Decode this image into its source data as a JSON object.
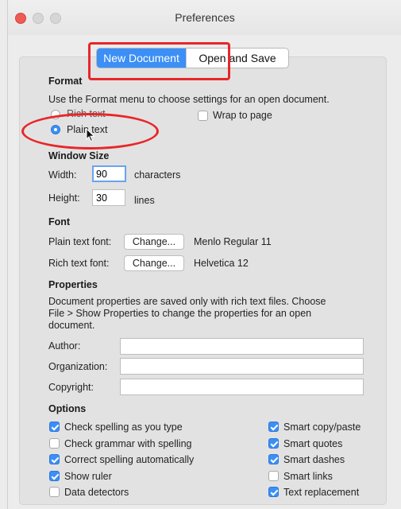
{
  "window": {
    "title": "Preferences"
  },
  "tabs": {
    "new_document": "New Document",
    "open_save": "Open and Save"
  },
  "format": {
    "heading": "Format",
    "description": "Use the Format menu to choose settings for an open document.",
    "rich_text": "Rich text",
    "plain_text": "Plain text",
    "wrap_to_page": "Wrap to page",
    "selected": "plain_text"
  },
  "window_size": {
    "heading": "Window Size",
    "width_label": "Width:",
    "width_value": "90",
    "width_unit": "characters",
    "height_label": "Height:",
    "height_value": "30",
    "height_unit": "lines"
  },
  "font": {
    "heading": "Font",
    "plain_label": "Plain text font:",
    "plain_button": "Change...",
    "plain_value": "Menlo Regular 11",
    "rich_label": "Rich text font:",
    "rich_button": "Change...",
    "rich_value": "Helvetica 12"
  },
  "properties": {
    "heading": "Properties",
    "description_line1": "Document properties are saved only with rich text files. Choose",
    "description_line2": "File > Show Properties to change the properties for an open",
    "description_line3": "document.",
    "author_label": "Author:",
    "organization_label": "Organization:",
    "copyright_label": "Copyright:",
    "author_value": "",
    "organization_value": "",
    "copyright_value": ""
  },
  "options": {
    "heading": "Options",
    "left": [
      {
        "label": "Check spelling as you type",
        "checked": true
      },
      {
        "label": "Check grammar with spelling",
        "checked": false
      },
      {
        "label": "Correct spelling automatically",
        "checked": true
      },
      {
        "label": "Show ruler",
        "checked": true
      },
      {
        "label": "Data detectors",
        "checked": false
      }
    ],
    "right": [
      {
        "label": "Smart copy/paste",
        "checked": true
      },
      {
        "label": "Smart quotes",
        "checked": true
      },
      {
        "label": "Smart dashes",
        "checked": true
      },
      {
        "label": "Smart links",
        "checked": false
      },
      {
        "label": "Text replacement",
        "checked": true
      }
    ]
  },
  "colors": {
    "accent": "#3b8ff6",
    "annotation": "#e8262a"
  }
}
